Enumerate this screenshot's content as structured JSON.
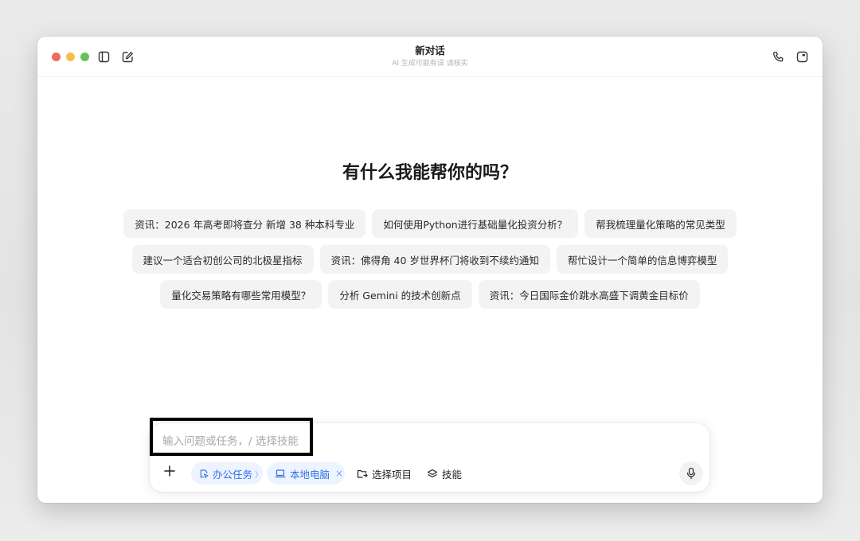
{
  "window": {
    "title": "新对话",
    "subtitle": "AI 生成可能有误 请核实"
  },
  "main": {
    "heading": "有什么我能帮你的吗？",
    "suggestions": [
      [
        "资讯：2026 年高考即将查分 新增 38 种本科专业",
        "如何使用Python进行基础量化投资分析？",
        "帮我梳理量化策略的常见类型"
      ],
      [
        "建议一个适合初创公司的北极星指标",
        "资讯：佛得角 40 岁世界杯门将收到不续约通知",
        "帮忙设计一个简单的信息博弈模型"
      ],
      [
        "量化交易策略有哪些常用模型？",
        "分析 Gemini 的技术创新点",
        "资讯：今日国际金价跳水高盛下调黄金目标价"
      ]
    ]
  },
  "composer": {
    "placeholder": "输入问题或任务，/ 选择技能",
    "office_task_label": "办公任务",
    "office_task_chevron": "〉",
    "local_pc_label": "本地电脑",
    "local_pc_close": "×",
    "select_project_label": "选择项目",
    "skills_label": "技能"
  },
  "colors": {
    "accent": "#2e6fe6",
    "pill_bg": "#eef4ff",
    "chip_bg": "#f3f3f3"
  }
}
